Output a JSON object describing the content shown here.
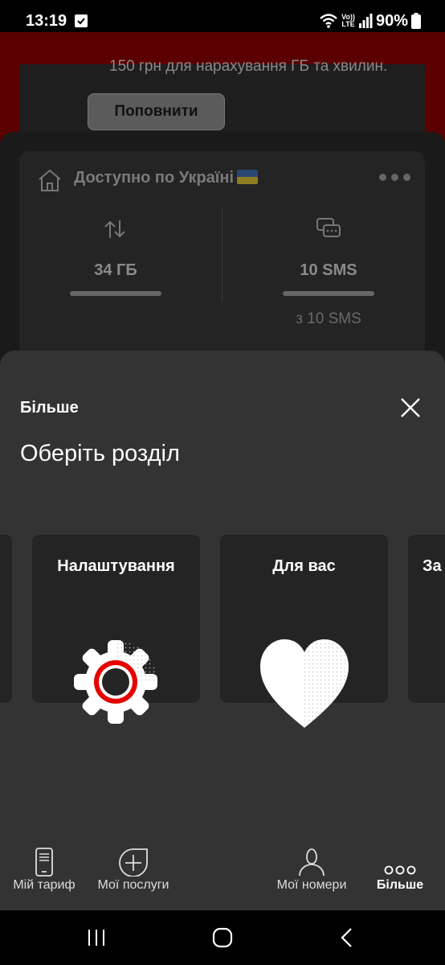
{
  "status_bar": {
    "time": "13:19",
    "battery": "90%",
    "network_top": "Vo))",
    "network_bottom": "LTE"
  },
  "background": {
    "topup_text": "150 грн для нарахування ГБ та хвилин.",
    "topup_button": "Поповнити",
    "balance_title": "Доступно по Україні",
    "data_value": "34 ГБ",
    "sms_value": "10 SMS",
    "sms_total": "з 10 SMS"
  },
  "sheet": {
    "heading": "Більше",
    "subtitle": "Оберіть розділ",
    "tiles": [
      {
        "label": "Налаштування",
        "icon": "gear-icon"
      },
      {
        "label": "Для вас",
        "icon": "heart-icon"
      },
      {
        "label": "За",
        "icon": ""
      }
    ]
  },
  "bottom_nav": [
    {
      "label": "Мій тариф",
      "icon": "phone-icon"
    },
    {
      "label": "Мої послуги",
      "icon": "plus-circle-icon"
    },
    {
      "label": "Мої номери",
      "icon": "person-icon"
    },
    {
      "label": "Більше",
      "icon": "more-dots-icon",
      "active": true
    }
  ],
  "colors": {
    "accent_red": "#e60000",
    "sheet_bg": "#333333",
    "tile_bg": "#242424"
  }
}
